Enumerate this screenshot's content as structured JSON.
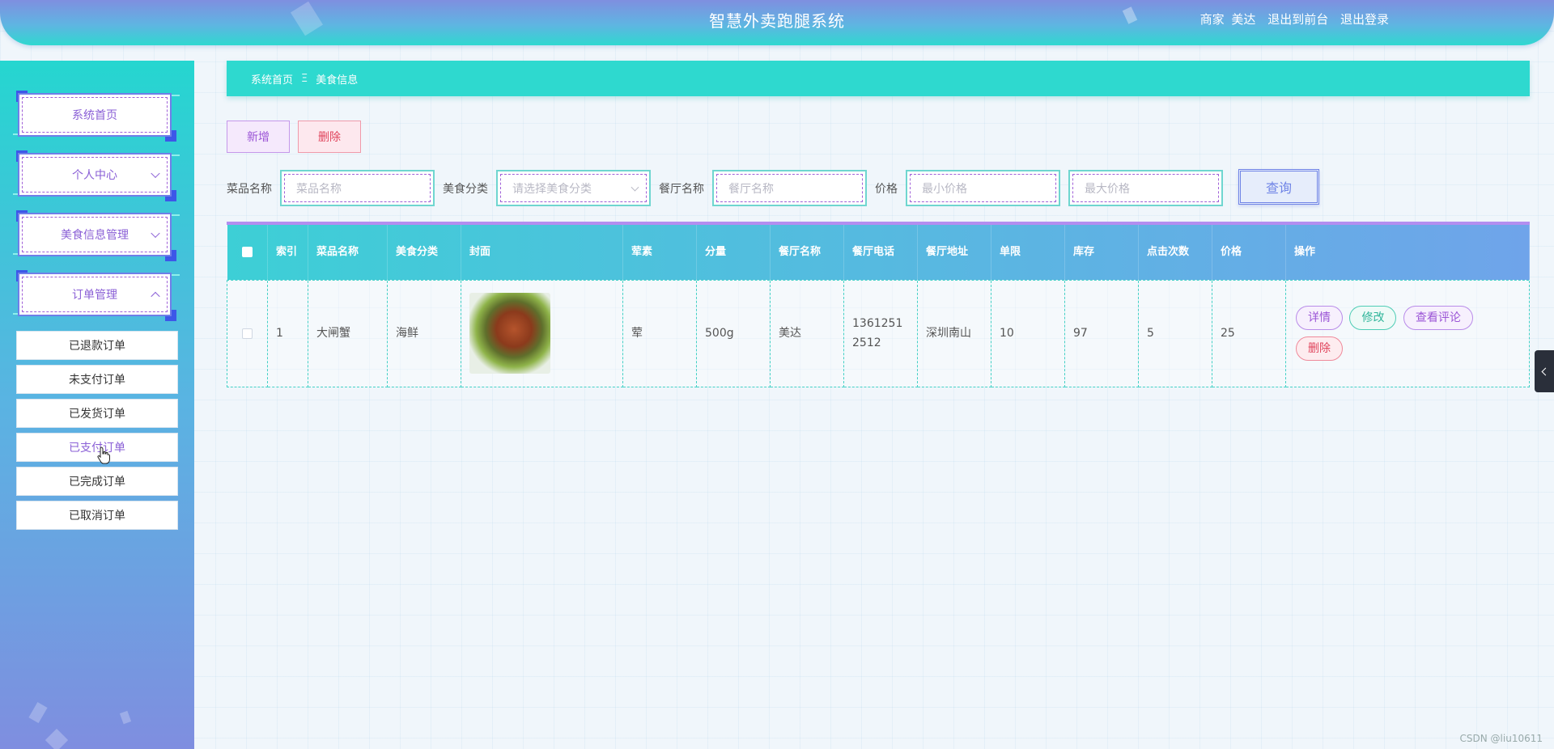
{
  "header": {
    "title": "智慧外卖跑腿系统",
    "role": "商家",
    "username": "美达",
    "front_link": "退出到前台",
    "logout_link": "退出登录"
  },
  "sidebar": {
    "menus": [
      {
        "label": "系统首页"
      },
      {
        "label": "个人中心"
      },
      {
        "label": "美食信息管理"
      },
      {
        "label": "订单管理"
      }
    ],
    "order_submenu": [
      {
        "label": "已退款订单"
      },
      {
        "label": "未支付订单"
      },
      {
        "label": "已发货订单"
      },
      {
        "label": "已支付订单"
      },
      {
        "label": "已完成订单"
      },
      {
        "label": "已取消订单"
      }
    ]
  },
  "breadcrumb": {
    "home": "系统首页",
    "separator": "Ξ",
    "current": "美食信息"
  },
  "toolbar": {
    "add_label": "新增",
    "delete_label": "删除"
  },
  "filters": {
    "name_label": "菜品名称",
    "name_placeholder": "菜品名称",
    "category_label": "美食分类",
    "category_placeholder": "请选择美食分类",
    "restaurant_label": "餐厅名称",
    "restaurant_placeholder": "餐厅名称",
    "price_label": "价格",
    "min_price_placeholder": "最小价格",
    "max_price_placeholder": "最大价格",
    "query_label": "查询"
  },
  "table": {
    "headers": {
      "index": "索引",
      "name": "菜品名称",
      "category": "美食分类",
      "cover": "封面",
      "meat": "荤素",
      "portion": "分量",
      "restaurant": "餐厅名称",
      "phone": "餐厅电话",
      "address": "餐厅地址",
      "limit": "单限",
      "stock": "库存",
      "clicks": "点击次数",
      "price": "价格",
      "actions": "操作"
    },
    "rows": [
      {
        "index": "1",
        "name": "大闸蟹",
        "category": "海鲜",
        "meat": "荤",
        "portion": "500g",
        "restaurant": "美达",
        "phone": "13612512512",
        "address": "深圳南山",
        "limit": "10",
        "stock": "97",
        "clicks": "5",
        "price": "25"
      }
    ],
    "actions": {
      "detail": "详情",
      "edit": "修改",
      "review": "查看评论",
      "delete": "删除"
    }
  },
  "watermark": "CSDN @liu10611"
}
